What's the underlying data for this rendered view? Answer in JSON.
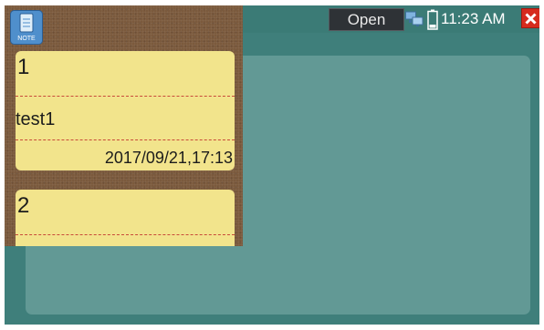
{
  "status_bar": {
    "open_label": "Open",
    "time": "11:23 AM"
  },
  "note_app": {
    "icon_label": "NOTE",
    "notes": [
      {
        "number": "1",
        "text": "test1",
        "date": "2017/09/21,17:13"
      },
      {
        "number": "2"
      }
    ]
  },
  "icons": [
    "note-app-icon",
    "network-icon",
    "battery-icon",
    "close-icon"
  ],
  "colors": {
    "screen_bg": "#3f7f7b",
    "content_panel": "#629995",
    "note_card": "#f2e48c",
    "close_button": "#d62b1e"
  }
}
